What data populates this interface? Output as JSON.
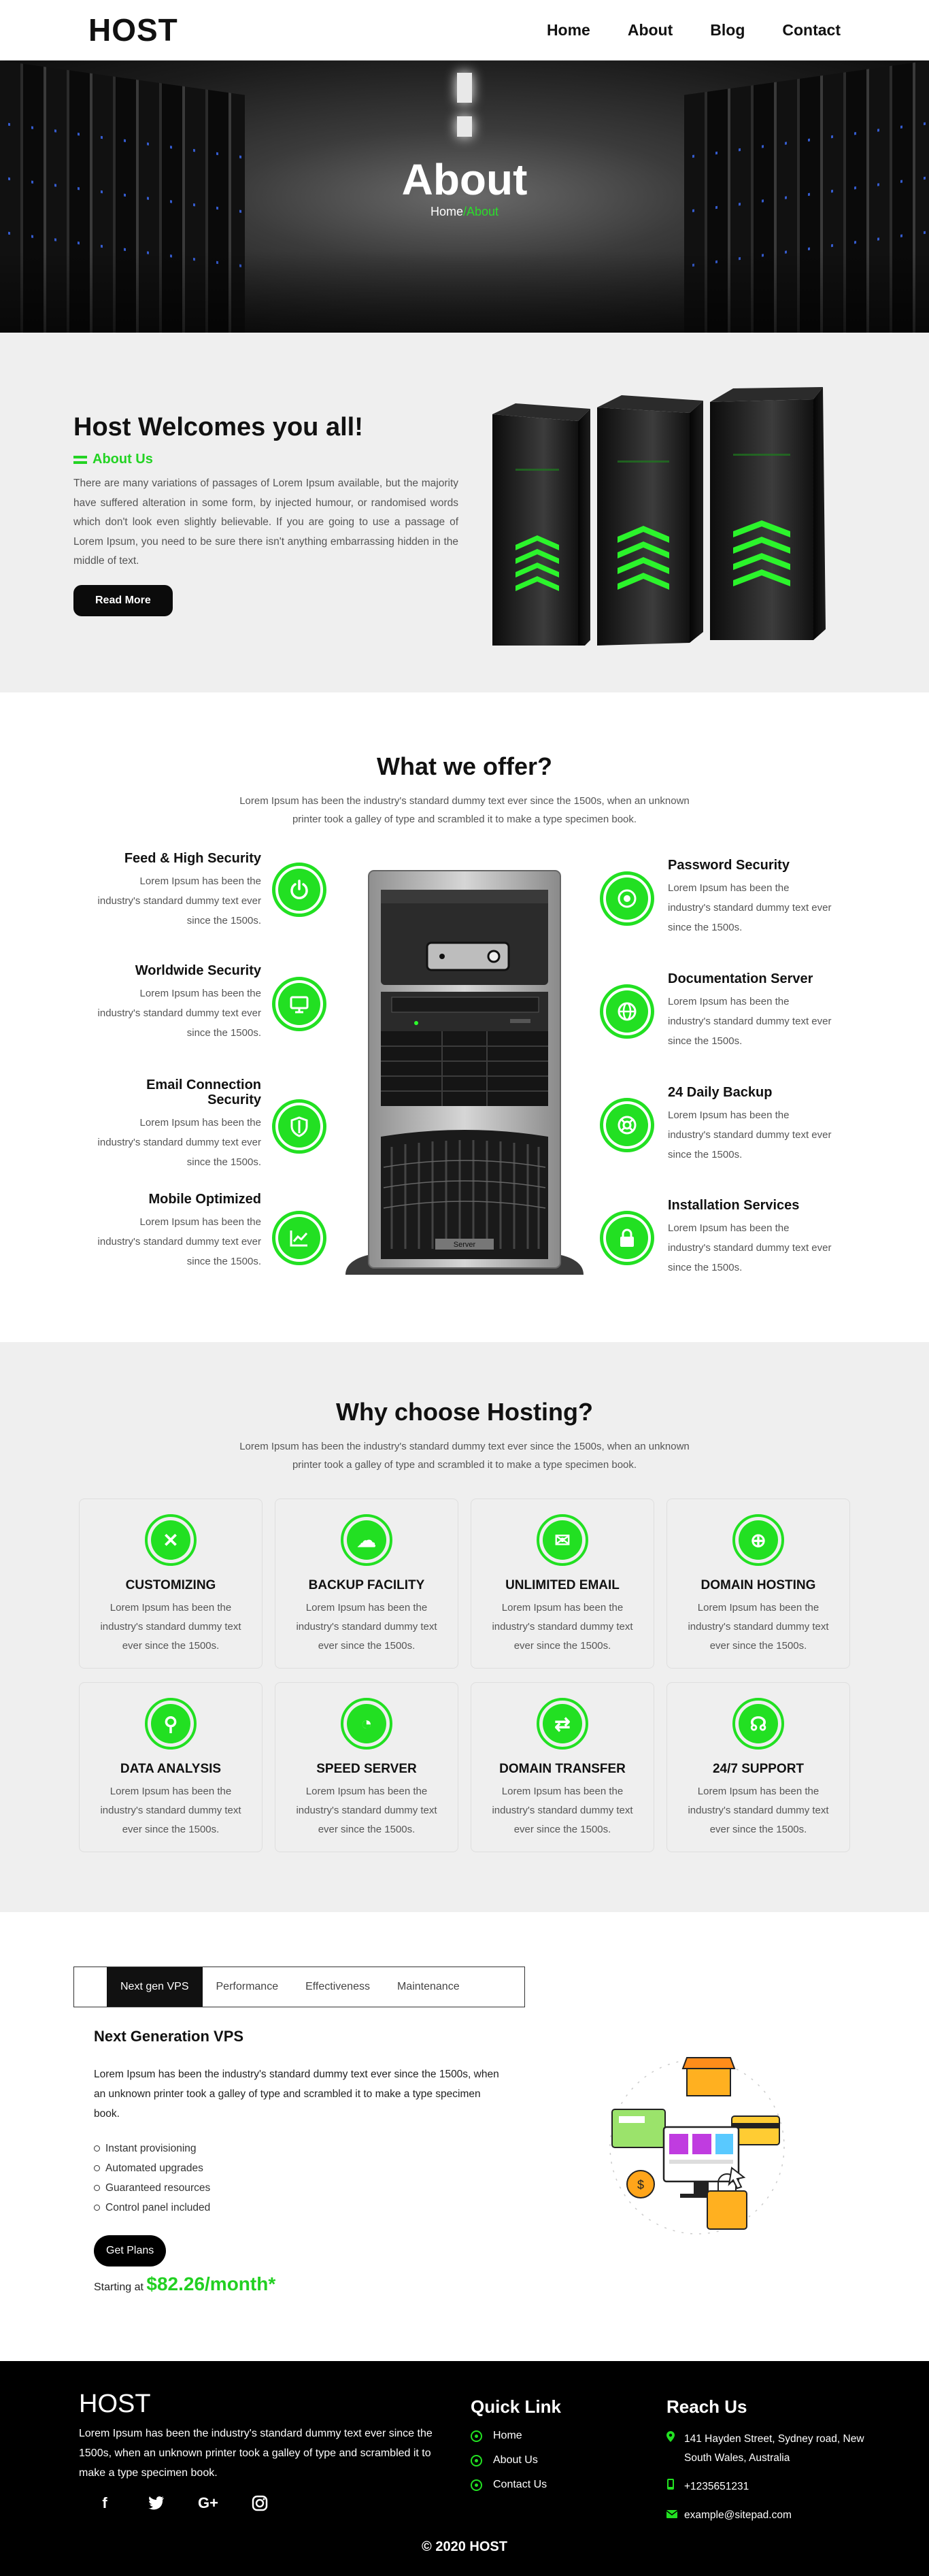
{
  "header": {
    "logo": "HOST",
    "nav": [
      "Home",
      "About",
      "Blog",
      "Contact"
    ]
  },
  "hero": {
    "title": "About",
    "crumb_home": "Home",
    "crumb_sep": "/",
    "crumb_current": "About"
  },
  "welcome": {
    "title": "Host Welcomes you all!",
    "subtitle": "About Us",
    "text": "There are many variations of passages of Lorem Ipsum available, but the majority have suffered alteration in some form, by injected humour, or randomised words which don't look even slightly believable. If you are going to use a passage of Lorem Ipsum, you need to be sure there isn't anything embarrassing hidden in the middle of text.",
    "button": "Read More"
  },
  "offer": {
    "title": "What we offer?",
    "desc": "Lorem Ipsum has been the industry's standard dummy text ever since the 1500s, when an unknown printer took a galley of type and scrambled it to make a type specimen book.",
    "left": [
      {
        "title": "Feed & High Security",
        "text": "Lorem Ipsum has been the industry's standard dummy text ever since the 1500s.",
        "icon": "power-icon"
      },
      {
        "title": "Worldwide Security",
        "text": "Lorem Ipsum has been the industry's standard dummy text ever since the 1500s.",
        "icon": "monitor-icon"
      },
      {
        "title": "Email Connection Security",
        "text": "Lorem Ipsum has been the industry's standard dummy text ever since the 1500s.",
        "icon": "shield-icon"
      },
      {
        "title": "Mobile Optimized",
        "text": "Lorem Ipsum has been the industry's standard dummy text ever since the 1500s.",
        "icon": "chart-icon"
      }
    ],
    "right": [
      {
        "title": "Password Security",
        "text": "Lorem Ipsum has been the industry's standard dummy text ever since the 1500s.",
        "icon": "target-icon"
      },
      {
        "title": "Documentation Server",
        "text": "Lorem Ipsum has been the industry's standard dummy text ever since the 1500s.",
        "icon": "globe-icon"
      },
      {
        "title": "24 Daily Backup",
        "text": "Lorem Ipsum has been the industry's standard dummy text ever since the 1500s.",
        "icon": "lifebuoy-icon"
      },
      {
        "title": "Installation Services",
        "text": "Lorem Ipsum has been the industry's standard dummy text ever since the 1500s.",
        "icon": "lock-icon"
      }
    ],
    "server_label": "Server"
  },
  "why": {
    "title": "Why choose Hosting?",
    "desc": "Lorem Ipsum has been the industry's standard dummy text ever since the 1500s, when an unknown printer took a galley of type and scrambled it to make a type specimen book.",
    "cards": [
      {
        "title": "CUSTOMIZING",
        "text": "Lorem Ipsum has been the industry's standard dummy text ever since the 1500s.",
        "icon": "tools-icon",
        "glyph": "✕"
      },
      {
        "title": "BACKUP FACILITY",
        "text": "Lorem Ipsum has been the industry's standard dummy text ever since the 1500s.",
        "icon": "cloud-icon",
        "glyph": "☁"
      },
      {
        "title": "UNLIMITED EMAIL",
        "text": "Lorem Ipsum has been the industry's standard dummy text ever since the 1500s.",
        "icon": "envelope-icon",
        "glyph": "✉"
      },
      {
        "title": "DOMAIN HOSTING",
        "text": "Lorem Ipsum has been the industry's standard dummy text ever since the 1500s.",
        "icon": "globe-icon",
        "glyph": "⊕"
      },
      {
        "title": "DATA ANALYSIS",
        "text": "Lorem Ipsum has been the industry's standard dummy text ever since the 1500s.",
        "icon": "magnifier-icon",
        "glyph": "⚲"
      },
      {
        "title": "SPEED SERVER",
        "text": "Lorem Ipsum has been the industry's standard dummy text ever since the 1500s.",
        "icon": "speedometer-icon",
        "glyph": "◔"
      },
      {
        "title": "DOMAIN TRANSFER",
        "text": "Lorem Ipsum has been the industry's standard dummy text ever since the 1500s.",
        "icon": "transfer-icon",
        "glyph": "⇄"
      },
      {
        "title": "24/7 SUPPORT",
        "text": "Lorem Ipsum has been the industry's standard dummy text ever since the 1500s.",
        "icon": "headset-icon",
        "glyph": "☊"
      }
    ]
  },
  "vps": {
    "tabs": [
      "Next gen VPS",
      "Performance",
      "Effectiveness",
      "Maintenance"
    ],
    "title": "Next Generation VPS",
    "text": "Lorem Ipsum has been the industry's standard dummy text ever since the 1500s, when an unknown printer took a galley of type and scrambled it to make a type specimen book.",
    "list": [
      "Instant provisioning",
      "Automated upgrades",
      "Guaranteed resources",
      "Control panel included"
    ],
    "button": "Get Plans",
    "starting": "Starting at",
    "price": "$82.26/month*"
  },
  "footer": {
    "logo": "HOST",
    "desc": "Lorem Ipsum has been the industry's standard dummy text ever since the 1500s, when an unknown printer took a galley of type and scrambled it to make a type specimen book.",
    "socials": [
      {
        "icon": "facebook-icon",
        "glyph": "f"
      },
      {
        "icon": "twitter-icon",
        "glyph": "t"
      },
      {
        "icon": "google-plus-icon",
        "glyph": "G+"
      },
      {
        "icon": "instagram-icon",
        "glyph": "◎"
      }
    ],
    "quick_title": "Quick Link",
    "quick_links": [
      "Home",
      "About Us",
      "Contact Us"
    ],
    "reach_title": "Reach Us",
    "address": "141 Hayden Street, Sydney road, New South Wales, Australia",
    "phone": "+1235651231",
    "email": "example@sitepad.com",
    "copyright": "© 2020 HOST"
  },
  "colors": {
    "accent": "#22e022",
    "dark": "#000000",
    "light_bg": "#efefef"
  }
}
